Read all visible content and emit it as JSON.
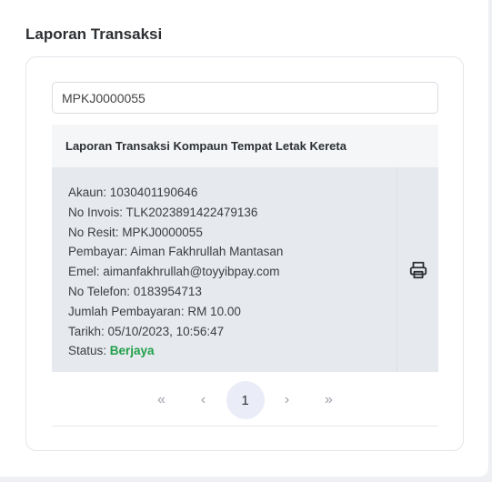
{
  "page": {
    "title": "Laporan Transaksi"
  },
  "search": {
    "value": "MPKJ0000055"
  },
  "table": {
    "header": "Laporan Transaksi Kompaun Tempat Letak Kereta",
    "rows": [
      {
        "akaun": "Akaun: 1030401190646",
        "invois": "No Invois: TLK2023891422479136",
        "resit": "No Resit: MPKJ0000055",
        "pembayar": "Pembayar: Aiman Fakhrullah Mantasan",
        "emel": "Emel: aimanfakhrullah@toyyibpay.com",
        "telefon": "No Telefon: 0183954713",
        "jumlah": "Jumlah Pembayaran: RM 10.00",
        "tarikh": "Tarikh: 05/10/2023, 10:56:47",
        "status_label": "Status: ",
        "status_value": "Berjaya",
        "action_icon": "printer-icon"
      }
    ]
  },
  "pagination": {
    "first": "«",
    "prev": "‹",
    "current": "1",
    "next": "›",
    "last": "»"
  },
  "colors": {
    "status_success": "#22a04b",
    "row_bg": "#e6e9ed",
    "header_bg": "#f4f6f8",
    "active_page_bg": "#eaedf7"
  }
}
